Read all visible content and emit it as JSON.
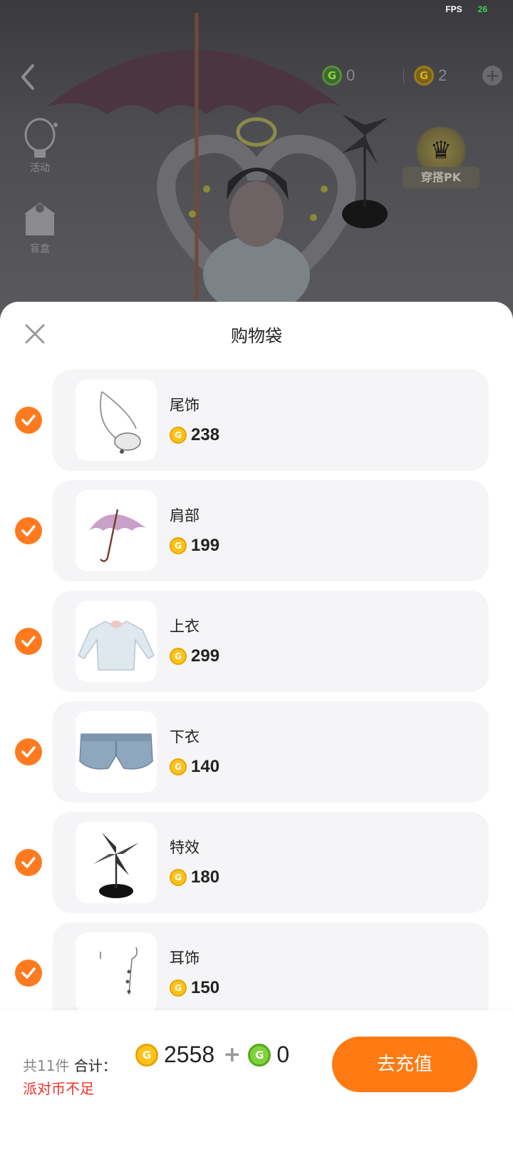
{
  "status": {
    "fps_label": "FPS",
    "fps_value": "26"
  },
  "wallet": {
    "party_coin": "0",
    "gold_coin": "2"
  },
  "side_menu": {
    "activity_label": "活动",
    "gift_label": "盲盒"
  },
  "pk": {
    "label": "穿搭PK"
  },
  "sheet": {
    "title": "购物袋"
  },
  "items": [
    {
      "name": "尾饰",
      "price": "238",
      "checked": true,
      "icon": "bag-charm-icon"
    },
    {
      "name": "肩部",
      "price": "199",
      "checked": true,
      "icon": "umbrella-icon"
    },
    {
      "name": "上衣",
      "price": "299",
      "checked": true,
      "icon": "top-shirt-icon"
    },
    {
      "name": "下衣",
      "price": "140",
      "checked": true,
      "icon": "denim-shorts-icon"
    },
    {
      "name": "特效",
      "price": "180",
      "checked": true,
      "icon": "pinwheel-icon"
    },
    {
      "name": "耳饰",
      "price": "150",
      "checked": true,
      "icon": "earring-icon"
    }
  ],
  "footer": {
    "count_text": "共11件",
    "total_label": "合计：",
    "gold_total": "2558",
    "plus": "+",
    "party_total": "0",
    "warning": "派对币不足",
    "button_label": "去充值"
  },
  "colors": {
    "accent": "#ff7a12",
    "check": "#ff7a1f",
    "warning": "#f0322a",
    "gold_coin": "#ffc21a",
    "party_coin": "#7ed23a"
  }
}
